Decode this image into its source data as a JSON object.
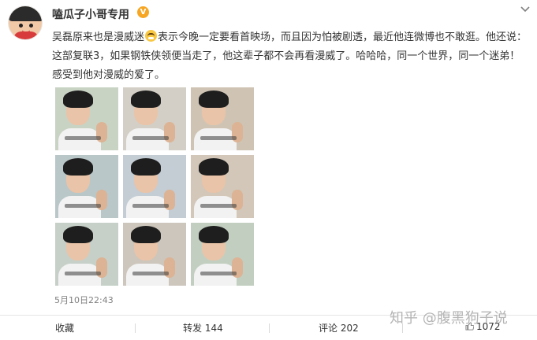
{
  "post": {
    "username": "嗑瓜子小哥专用",
    "vip_badge": "V",
    "text_before_emoji": "吴磊原来也是漫威迷",
    "text_after_emoji": "表示今晚一定要看首映场，而且因为怕被剧透，最近他连微博也不敢逛。他还说：这部复联3，如果钢铁侠领便当走了，他这辈子都不会再看漫威了。哈哈哈，同一个世界，同一个迷弟！感受到他对漫威的爱了。",
    "emoji": "laughing-emoji",
    "timestamp": "5月10日22:43",
    "more_icon": "chevron-down-icon"
  },
  "photos": [
    {
      "bg": "#c9d3c4"
    },
    {
      "bg": "#d3cfc6"
    },
    {
      "bg": "#cfc4b4"
    },
    {
      "bg": "#b9c7c9"
    },
    {
      "bg": "#c4ccd4"
    },
    {
      "bg": "#d2c7b8"
    },
    {
      "bg": "#c6d0c8"
    },
    {
      "bg": "#ccc6bc"
    },
    {
      "bg": "#c2cfc0"
    }
  ],
  "actions": {
    "favorite_label": "收藏",
    "repost_label": "转发 144",
    "comment_label": "评论 202",
    "like_count": "1072"
  },
  "watermark": "知乎 @腹黑狗子说"
}
